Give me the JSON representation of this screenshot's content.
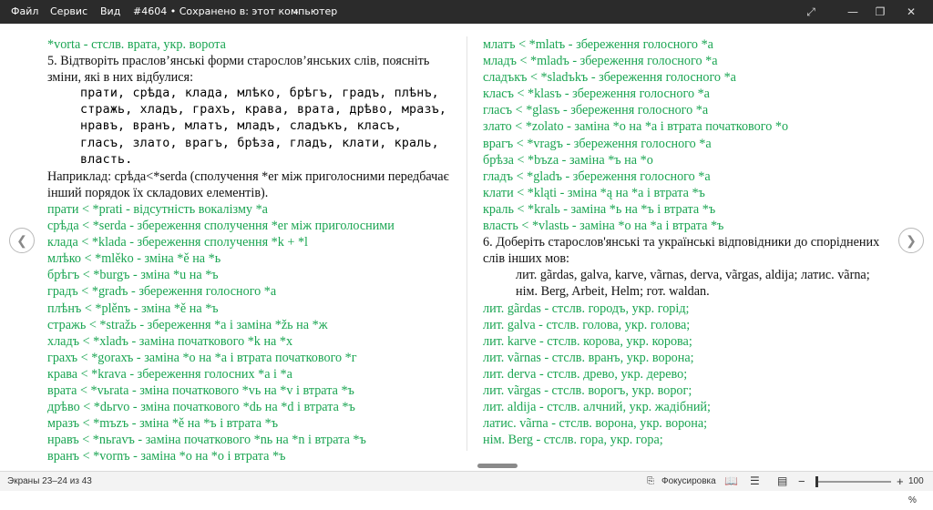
{
  "titlebar": {
    "menu": [
      "Файл",
      "Сервис",
      "Вид"
    ],
    "doc_title": "#4604 • Сохранено в: этот компьютер",
    "chevron": "chevron-down-icon"
  },
  "left_column": {
    "lines": [
      {
        "text": "*vorta - стслв. врата, укр. ворота",
        "kind": "g"
      },
      {
        "text": "5. Відтворіть праслов’янські форми старослов’янських слів, поясніть зміни, які в них відбулися:",
        "kind": "b"
      },
      {
        "text": "прати, срѣда, клада, млѣко, брѣгъ, градъ, плѣнъ, стражь, хладъ, грахъ, крава, врата, дрѣво, мразъ, нравъ, вранъ, млатъ, младъ, сладъкъ, класъ, гласъ, злато, врагъ, брѣза, гладъ, клати, краль, власть.",
        "kind": "rus"
      },
      {
        "text": "Наприклад: срѣда<*serda (сполучення *er між приголосними передбачає інший порядок їх складових елементів).",
        "kind": "b"
      },
      {
        "text": "прати < *prati - відсутність вокалізму *a",
        "kind": "g"
      },
      {
        "text": "срѣда < *serda - збереження сполучення *er між приголосними",
        "kind": "g"
      },
      {
        "text": "клада < *klada - збереження сполучення *k + *l",
        "kind": "g"
      },
      {
        "text": "млѣко < *mlěko - зміна *ě на *ь",
        "kind": "g"
      },
      {
        "text": "брѣгъ < *burgъ - зміна *u на *ъ",
        "kind": "g"
      },
      {
        "text": "градъ < *gradъ - збереження голосного *a",
        "kind": "g"
      },
      {
        "text": "плѣнъ < *plěnъ - зміна *ě на *ъ",
        "kind": "g"
      },
      {
        "text": "стражь < *stražь - збереження *a і заміна *žь на *ж",
        "kind": "g"
      },
      {
        "text": "хладъ < *xladъ - заміна початкового *k на *x",
        "kind": "g"
      },
      {
        "text": "грахъ < *gorахъ - заміна *о на *a і втрата початкового *г",
        "kind": "g"
      },
      {
        "text": "крава < *krava - збереження голосних *a і *a",
        "kind": "g"
      },
      {
        "text": "врата < *vьrata - зміна початкового *vь на *v і втрата *ъ",
        "kind": "g"
      },
      {
        "text": "дрѣво < *dьrvo - зміна початкового *dь на *d і втрата *ъ",
        "kind": "g"
      },
      {
        "text": "мразъ < *mъzъ - зміна *ě на *ъ і втрата *ъ",
        "kind": "g"
      },
      {
        "text": "нравъ < *nьravъ - заміна початкового *nь на *n і втрата *ъ",
        "kind": "g"
      },
      {
        "text": "вранъ < *vornъ - заміна *о на *о і втрата *ъ",
        "kind": "g"
      }
    ]
  },
  "right_column": {
    "lines": [
      {
        "text": "млатъ < *mlatъ - збереження голосного *a",
        "kind": "g"
      },
      {
        "text": "младъ < *mladъ - збереження голосного *a",
        "kind": "g"
      },
      {
        "text": "сладъкъ < *sladъkъ - збереження голосного *a",
        "kind": "g"
      },
      {
        "text": "класъ < *klasъ - збереження голосного *a",
        "kind": "g"
      },
      {
        "text": "гласъ < *glasъ - збереження голосного *a",
        "kind": "g"
      },
      {
        "text": "злато < *zolato - заміна *о на *a і втрата початкового *о",
        "kind": "g"
      },
      {
        "text": "врагъ < *vragъ - збереження голосного *a",
        "kind": "g"
      },
      {
        "text": "брѣза < *bъza - заміна *ъ на *о",
        "kind": "g"
      },
      {
        "text": "гладъ < *gladъ - збереження голосного *a",
        "kind": "g"
      },
      {
        "text": "клати < *kląti - зміна *ą на *a і втрата *ъ",
        "kind": "g"
      },
      {
        "text": "краль < *kralь - заміна *ь на *ъ і втрата *ъ",
        "kind": "g"
      },
      {
        "text": "власть < *vlastь - заміна *о на *a і втрата *ъ",
        "kind": "g"
      },
      {
        "text": "6. Доберіть старослов'янські та українські відповідники до споріднених слів інших мов:",
        "kind": "b"
      },
      {
        "text": "лит. gãrdas, galva, karve, vãrnas, derva, vãrgas, aldija; латис. vãrna; нім. Berg, Arbeit, Helm; гот. waldan.",
        "kind": "bi"
      },
      {
        "text": "лит. gãrdas - стслв. городъ, укр. горід;",
        "kind": "g"
      },
      {
        "text": "лит. galva - стслв. голова, укр. голова;",
        "kind": "g"
      },
      {
        "text": "лит. karve - стслв. корова, укр. корова;",
        "kind": "g"
      },
      {
        "text": "лит. vãrnas - стслв. вранъ, укр. ворона;",
        "kind": "g"
      },
      {
        "text": "лит. derva - стслв. древо, укр. дерево;",
        "kind": "g"
      },
      {
        "text": "лит. vãrgas - стслв. ворогъ, укр. ворог;",
        "kind": "g"
      },
      {
        "text": "лит. aldija - стслв. алчний, укр. жадібний;",
        "kind": "g"
      },
      {
        "text": "латис. vãrna - стслв. ворона, укр. ворона;",
        "kind": "g"
      },
      {
        "text": "нім. Berg - стслв. гора, укр. гора;",
        "kind": "g"
      }
    ]
  },
  "nav": {
    "prev_icon": "chevron-left-icon",
    "next_icon": "chevron-right-icon"
  },
  "statusbar": {
    "screens": "Экраны 23–24 из 43",
    "focus": "Фокусировка",
    "zoom": "100 %"
  },
  "colors": {
    "answer_green": "#1aa552",
    "titlebar_bg": "#2b2b2b"
  }
}
